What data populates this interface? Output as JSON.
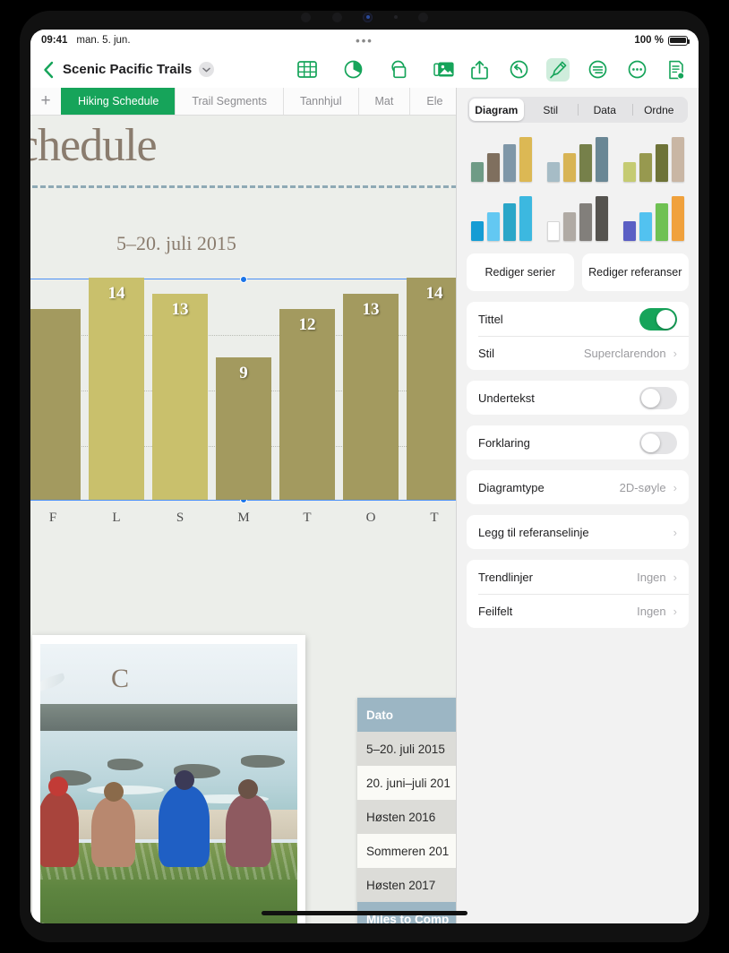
{
  "status_bar": {
    "time": "09:41",
    "date": "man. 5. jun.",
    "dots": "•••",
    "battery_text": "100 %"
  },
  "nav_bar": {
    "back_icon": "back-chevron-icon",
    "document_title": "Scenic Pacific Trails",
    "title_chevron": "⌄",
    "center_tools": [
      {
        "name": "insert-table-icon",
        "label": "Tabell"
      },
      {
        "name": "insert-chart-icon",
        "label": "Diagram"
      },
      {
        "name": "insert-shape-icon",
        "label": "Figur"
      },
      {
        "name": "insert-media-icon",
        "label": "Medier"
      }
    ],
    "right_tools": [
      {
        "name": "share-icon",
        "label": "Del"
      },
      {
        "name": "undo-icon",
        "label": "Angre"
      },
      {
        "name": "format-brush-icon",
        "label": "Format",
        "active": true
      },
      {
        "name": "comment-icon",
        "label": "Kommentar"
      },
      {
        "name": "more-icon",
        "label": "Mer"
      },
      {
        "name": "document-options-icon",
        "label": "Dokument"
      }
    ]
  },
  "sheet_tabs": {
    "add_label": "+",
    "items": [
      {
        "label": "Hiking Schedule",
        "selected": true
      },
      {
        "label": "Trail Segments",
        "selected": false
      },
      {
        "label": "Tannhjul",
        "selected": false
      },
      {
        "label": "Mat",
        "selected": false
      },
      {
        "label": "Ele",
        "selected": false
      }
    ]
  },
  "document": {
    "heading": "Schedule",
    "subtitle": "5–20. juli 2015",
    "table_caption": "C"
  },
  "chart_data": {
    "type": "bar",
    "title": "Schedule",
    "subtitle": "5–20. juli 2015",
    "categories": [
      "F",
      "L",
      "S",
      "M",
      "T",
      "O",
      "T"
    ],
    "values": [
      12,
      14,
      13,
      9,
      12,
      13,
      14
    ],
    "labels": [
      "",
      "14",
      "13",
      "9",
      "12",
      "13",
      "14"
    ],
    "colors": [
      "#a39a5f",
      "#c9c06c",
      "#c9c06c",
      "#a39a5f",
      "#a39a5f",
      "#a39a5f",
      "#a39a5f"
    ],
    "xlabel": "",
    "ylabel": "",
    "ylim": [
      0,
      14
    ],
    "grid": true,
    "legend": false,
    "selected": true
  },
  "data_table": {
    "header": "Dato",
    "rows": [
      "5–20. juli 2015",
      "20. juni–juli 201",
      "Høsten 2016",
      "Sommeren 201",
      "Høsten 2017"
    ],
    "footer": "Miles to Comp"
  },
  "panel": {
    "segments": [
      {
        "label": "Diagram",
        "selected": true
      },
      {
        "label": "Stil",
        "selected": false
      },
      {
        "label": "Data",
        "selected": false
      },
      {
        "label": "Ordne",
        "selected": false
      }
    ],
    "chart_styles": [
      {
        "name": "chart-style-1",
        "bars": [
          "#6f9b86",
          "#7f6f5e",
          "#7f97a8",
          "#dcb854"
        ]
      },
      {
        "name": "chart-style-2",
        "bars": [
          "#a6bcc6",
          "#d8b455",
          "#76804a",
          "#6a8795"
        ]
      },
      {
        "name": "chart-style-3",
        "bars": [
          "#c5cb73",
          "#97994f",
          "#6e7338",
          "#c9b6a4"
        ]
      },
      {
        "name": "chart-style-4",
        "bars": [
          "#159cd4",
          "#63c8f2",
          "#2ba6c8",
          "#3cb8e0"
        ]
      },
      {
        "name": "chart-style-5",
        "bars": [
          "#ffffff",
          "#b0aaa4",
          "#827f7b",
          "#55534f"
        ]
      },
      {
        "name": "chart-style-6",
        "bars": [
          "#5b5fc4",
          "#52c2f0",
          "#6fc153",
          "#f0a13c"
        ]
      }
    ],
    "buttons": [
      {
        "label": "Rediger serier",
        "name": "edit-series-button"
      },
      {
        "label": "Rediger referanser",
        "name": "edit-references-button"
      }
    ],
    "rows": [
      {
        "label": "Tittel",
        "control": "switch",
        "on": true
      },
      {
        "label": "Stil",
        "control": "value",
        "value": "Superclarendon"
      },
      {
        "label": "Undertekst",
        "control": "switch",
        "on": false
      },
      {
        "label": "Forklaring",
        "control": "switch",
        "on": false
      },
      {
        "label": "Diagramtype",
        "control": "value",
        "value": "2D-søyle"
      },
      {
        "label": "Legg til referanselinje",
        "control": "chevron",
        "value": ""
      },
      {
        "label": "Trendlinjer",
        "control": "value",
        "value": "Ingen"
      },
      {
        "label": "Feilfelt",
        "control": "value",
        "value": "Ingen"
      }
    ]
  },
  "colors": {
    "accent_green": "#16a45a",
    "selection_blue": "#1a74e8",
    "bar_light": "#c9c06c",
    "bar_dark": "#a39a5f",
    "table_header": "#9cb6c4"
  }
}
